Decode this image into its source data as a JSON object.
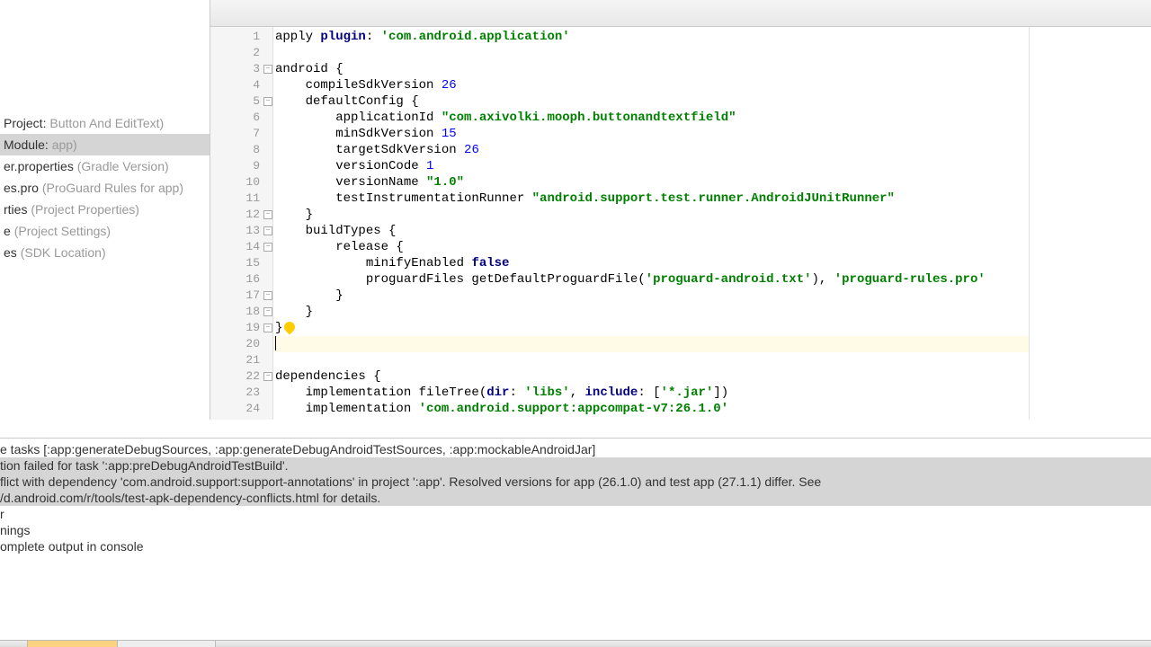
{
  "sidebar": {
    "items": [
      {
        "prefix": " Project: ",
        "gray": "Button And EditText)"
      },
      {
        "prefix": " Module: ",
        "gray": "app)"
      },
      {
        "prefix": "er.properties ",
        "gray": "(Gradle Version)"
      },
      {
        "prefix": "es.pro ",
        "gray": "(ProGuard Rules for app)"
      },
      {
        "prefix": "rties ",
        "gray": "(Project Properties)"
      },
      {
        "prefix": "e ",
        "gray": "(Project Settings)"
      },
      {
        "prefix": "es ",
        "gray": "(SDK Location)"
      }
    ]
  },
  "code": {
    "lines": [
      {
        "n": 1,
        "tokens": [
          {
            "t": "apply ",
            "c": "plain"
          },
          {
            "t": "plugin",
            "c": "kw"
          },
          {
            "t": ": ",
            "c": "plain"
          },
          {
            "t": "'com.android.application'",
            "c": "str"
          }
        ]
      },
      {
        "n": 2,
        "tokens": []
      },
      {
        "n": 3,
        "fold": true,
        "tokens": [
          {
            "t": "android {",
            "c": "plain"
          }
        ]
      },
      {
        "n": 4,
        "tokens": [
          {
            "t": "    compileSdkVersion ",
            "c": "plain"
          },
          {
            "t": "26",
            "c": "num"
          }
        ]
      },
      {
        "n": 5,
        "fold": true,
        "tokens": [
          {
            "t": "    defaultConfig {",
            "c": "plain"
          }
        ]
      },
      {
        "n": 6,
        "tokens": [
          {
            "t": "        applicationId ",
            "c": "plain"
          },
          {
            "t": "\"com.axivolki.mooph.buttonandtextfield\"",
            "c": "str"
          }
        ]
      },
      {
        "n": 7,
        "tokens": [
          {
            "t": "        minSdkVersion ",
            "c": "plain"
          },
          {
            "t": "15",
            "c": "num"
          }
        ]
      },
      {
        "n": 8,
        "tokens": [
          {
            "t": "        targetSdkVersion ",
            "c": "plain"
          },
          {
            "t": "26",
            "c": "num"
          }
        ]
      },
      {
        "n": 9,
        "tokens": [
          {
            "t": "        versionCode ",
            "c": "plain"
          },
          {
            "t": "1",
            "c": "num"
          }
        ]
      },
      {
        "n": 10,
        "tokens": [
          {
            "t": "        versionName ",
            "c": "plain"
          },
          {
            "t": "\"1.0\"",
            "c": "str"
          }
        ]
      },
      {
        "n": 11,
        "tokens": [
          {
            "t": "        testInstrumentationRunner ",
            "c": "plain"
          },
          {
            "t": "\"android.support.test.runner.AndroidJUnitRunner\"",
            "c": "str"
          }
        ]
      },
      {
        "n": 12,
        "fold": true,
        "tokens": [
          {
            "t": "    }",
            "c": "plain"
          }
        ]
      },
      {
        "n": 13,
        "fold": true,
        "tokens": [
          {
            "t": "    buildTypes {",
            "c": "plain"
          }
        ]
      },
      {
        "n": 14,
        "fold": true,
        "tokens": [
          {
            "t": "        release {",
            "c": "plain"
          }
        ]
      },
      {
        "n": 15,
        "tokens": [
          {
            "t": "            minifyEnabled ",
            "c": "plain"
          },
          {
            "t": "false",
            "c": "kw"
          }
        ]
      },
      {
        "n": 16,
        "tokens": [
          {
            "t": "            proguardFiles getDefaultProguardFile(",
            "c": "plain"
          },
          {
            "t": "'proguard-android.txt'",
            "c": "str"
          },
          {
            "t": "), ",
            "c": "plain"
          },
          {
            "t": "'proguard-rules.pro'",
            "c": "str"
          }
        ]
      },
      {
        "n": 17,
        "fold": true,
        "tokens": [
          {
            "t": "        }",
            "c": "plain"
          }
        ]
      },
      {
        "n": 18,
        "fold": true,
        "tokens": [
          {
            "t": "    }",
            "c": "plain"
          }
        ]
      },
      {
        "n": 19,
        "fold": true,
        "bulb": true,
        "tokens": [
          {
            "t": "}",
            "c": "plain"
          }
        ]
      },
      {
        "n": 20,
        "highlight": true,
        "caret": true,
        "tokens": []
      },
      {
        "n": 21,
        "tokens": []
      },
      {
        "n": 22,
        "fold": true,
        "tokens": [
          {
            "t": "dependencies {",
            "c": "plain"
          }
        ]
      },
      {
        "n": 23,
        "tokens": [
          {
            "t": "    implementation fileTree(",
            "c": "plain"
          },
          {
            "t": "dir",
            "c": "kw"
          },
          {
            "t": ": ",
            "c": "plain"
          },
          {
            "t": "'libs'",
            "c": "str"
          },
          {
            "t": ", ",
            "c": "plain"
          },
          {
            "t": "include",
            "c": "kw"
          },
          {
            "t": ": [",
            "c": "plain"
          },
          {
            "t": "'*.jar'",
            "c": "str"
          },
          {
            "t": "])",
            "c": "plain"
          }
        ]
      },
      {
        "n": 24,
        "tokens": [
          {
            "t": "    implementation ",
            "c": "plain"
          },
          {
            "t": "'com.android.support:appcompat-v7:26.1.0'",
            "c": "str"
          }
        ]
      }
    ]
  },
  "console": {
    "lines": [
      {
        "t": "e tasks [:app:generateDebugSources, :app:generateDebugAndroidTestSources, :app:mockableAndroidJar]",
        "error": false
      },
      {
        "t": "tion failed for task ':app:preDebugAndroidTestBuild'.",
        "error": true
      },
      {
        "t": "flict with dependency 'com.android.support:support-annotations' in project ':app'. Resolved versions for app (26.1.0) and test app (27.1.1) differ. See",
        "error": true
      },
      {
        "t": "/d.android.com/r/tools/test-apk-dependency-conflicts.html for details.",
        "error": true
      },
      {
        "t": "r",
        "error": false
      },
      {
        "t": "nings",
        "error": false
      },
      {
        "t": "omplete output in console",
        "error": false
      }
    ]
  }
}
